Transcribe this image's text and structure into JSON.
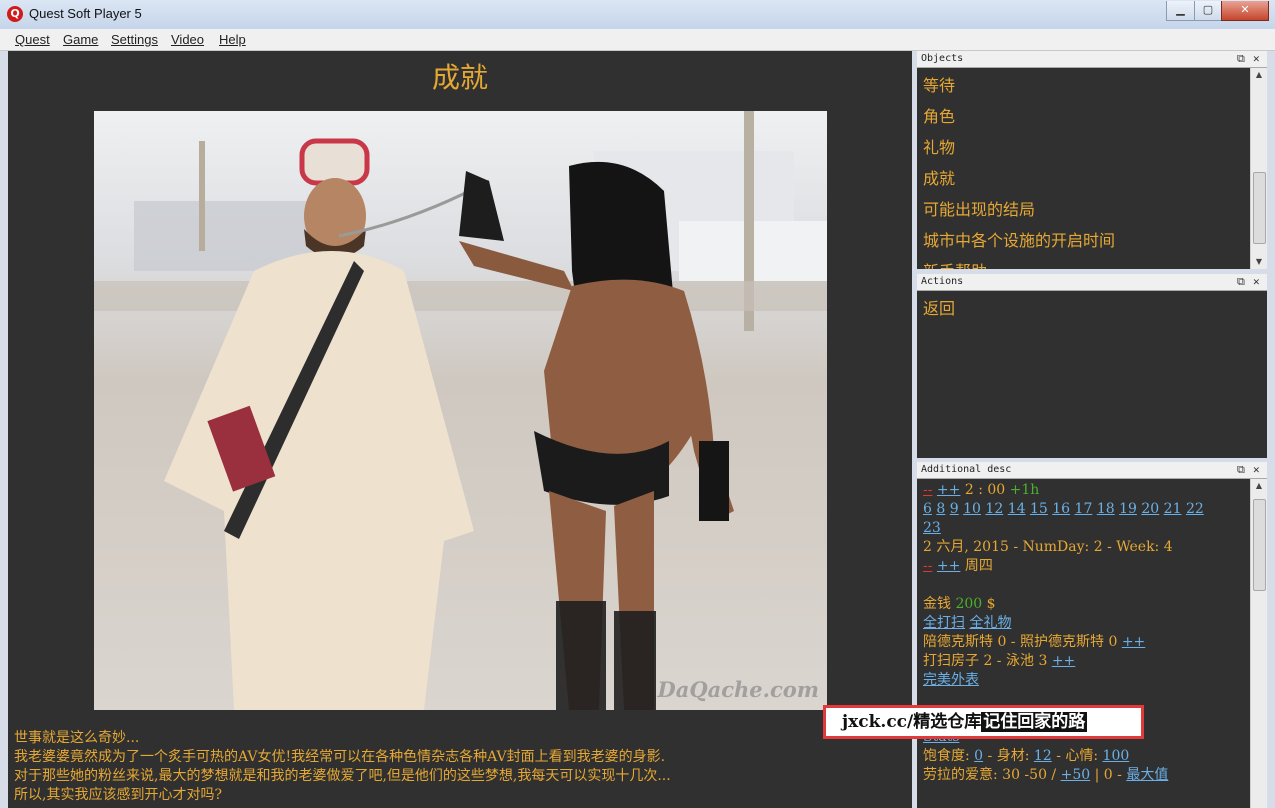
{
  "window": {
    "title": "Quest Soft Player 5",
    "icon": "quest-logo-icon"
  },
  "menu": [
    "Quest",
    "Game",
    "Settings",
    "Video",
    "Help"
  ],
  "main": {
    "title": "成就",
    "photo_watermark": "DaQache.com",
    "story_lines": [
      "世事就是这么奇妙...",
      "我老婆婆竟然成为了一个炙手可热的AV女优!我经常可以在各种色情杂志各种AV封面上看到我老婆的身影.",
      "对于那些她的粉丝来说,最大的梦想就是和我的老婆做爱了吧,但是他们的这些梦想,我每天可以实现十几次...",
      "所以,其实我应该感到开心才对吗?"
    ]
  },
  "objects_panel": {
    "title": "Objects",
    "items": [
      "等待",
      "角色",
      "礼物",
      "成就",
      "可能出现的结局",
      "城市中各个设施的开启时间",
      "新手帮助"
    ]
  },
  "actions_panel": {
    "title": "Actions",
    "items": [
      "返回"
    ]
  },
  "desc_panel": {
    "title": "Additional desc",
    "time_minus": "--",
    "time_plus": "++",
    "time": "2 : 00",
    "time_step": "+1h",
    "hours": [
      "6",
      "8",
      "9",
      "10",
      "12",
      "14",
      "15",
      "16",
      "17",
      "18",
      "19",
      "20",
      "21",
      "22",
      "23"
    ],
    "date_line": "2 六月, 2015 - NumDay: 2 - Week: 4",
    "day_minus": "--",
    "day_plus": "++",
    "weekday": "周四",
    "money_label": "金钱",
    "money_value": "200",
    "money_unit": "$",
    "clean_all": "全打扫",
    "gift_all": "全礼物",
    "escort_line": "陪德克斯特 0 - 照护德克斯特 0",
    "escort_plus": "++",
    "house_line": "打扫房子 2 - 泳池 3",
    "house_plus": "++",
    "perfect_look": "完美外表",
    "stats_link": "Stats",
    "satiety_label": "饱食度:",
    "satiety_value": "0",
    "body_label": "- 身材:",
    "body_value": "12",
    "mood_label": "- 心情:",
    "mood_value": "100",
    "love_label": "劳拉的爱意: 30 -50 /",
    "love_plus": "+50",
    "love_sep": "| 0 -",
    "love_max": "最大值"
  },
  "promo": {
    "prefix": "jxck.cc/精选仓库",
    "highlight": "记住回家的路"
  }
}
